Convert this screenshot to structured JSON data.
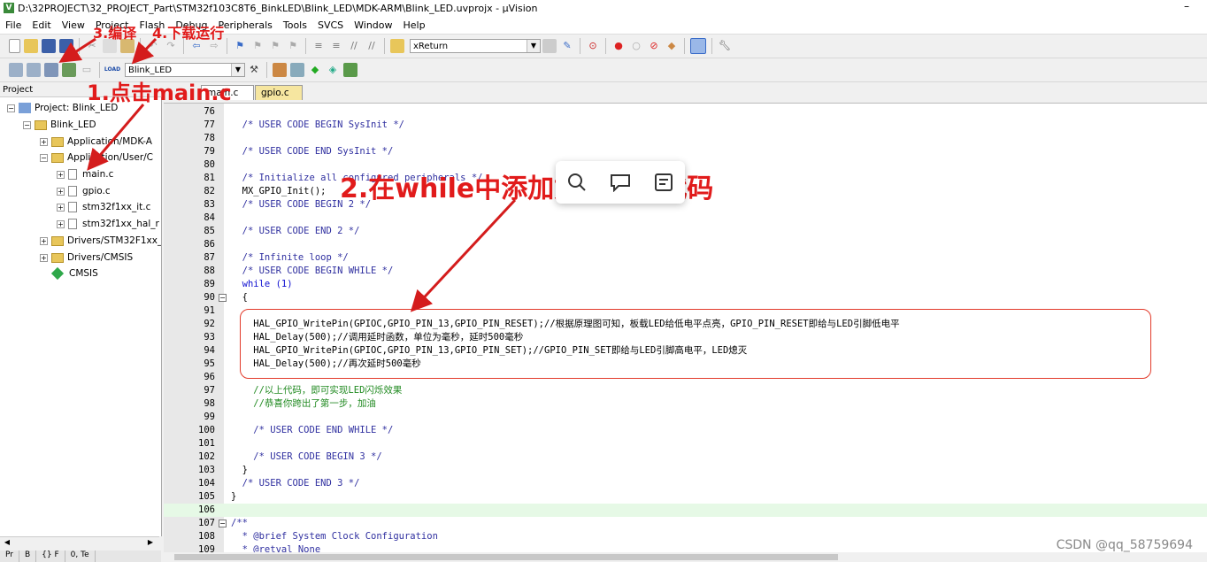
{
  "window": {
    "title": "D:\\32PROJECT\\32_PROJECT_Part\\STM32f103C8T6_BinkLED\\Blink_LED\\MDK-ARM\\Blink_LED.uvprojx - µVision",
    "app_icon_letter": "V",
    "minimize_glyph": "–"
  },
  "menu": [
    "File",
    "Edit",
    "View",
    "Project",
    "Flash",
    "Debug",
    "Peripherals",
    "Tools",
    "SVCS",
    "Window",
    "Help"
  ],
  "toolbar": {
    "find_combo_value": "xReturn",
    "target_combo_value": "Blink_LED",
    "load_label": "LOAD"
  },
  "project_panel": {
    "header": "Project",
    "tree": [
      {
        "label": "Project: Blink_LED",
        "indent": 0,
        "kind": "project",
        "expander": "−"
      },
      {
        "label": "Blink_LED",
        "indent": 1,
        "kind": "target",
        "expander": "−"
      },
      {
        "label": "Application/MDK-A",
        "indent": 2,
        "kind": "folder",
        "expander": "+"
      },
      {
        "label": "Application/User/C",
        "indent": 2,
        "kind": "folder",
        "expander": "−"
      },
      {
        "label": "main.c",
        "indent": 3,
        "kind": "file",
        "expander": "+"
      },
      {
        "label": "gpio.c",
        "indent": 3,
        "kind": "file",
        "expander": "+"
      },
      {
        "label": "stm32f1xx_it.c",
        "indent": 3,
        "kind": "file",
        "expander": "+"
      },
      {
        "label": "stm32f1xx_hal_r",
        "indent": 3,
        "kind": "file",
        "expander": "+"
      },
      {
        "label": "Drivers/STM32F1xx_",
        "indent": 2,
        "kind": "folder",
        "expander": "+"
      },
      {
        "label": "Drivers/CMSIS",
        "indent": 2,
        "kind": "folder",
        "expander": "+"
      },
      {
        "label": "CMSIS",
        "indent": 2,
        "kind": "diamond",
        "expander": ""
      }
    ],
    "bottom_tabs": [
      "Pr",
      "B",
      "{} F",
      "0, Te"
    ]
  },
  "editor": {
    "tabs": [
      "main.c",
      "gpio.c"
    ],
    "lines": [
      {
        "n": "76",
        "t": "",
        "c": "plain"
      },
      {
        "n": "77",
        "t": "  /* USER CODE BEGIN SysInit */",
        "c": "cm"
      },
      {
        "n": "78",
        "t": "",
        "c": "plain"
      },
      {
        "n": "79",
        "t": "  /* USER CODE END SysInit */",
        "c": "cm"
      },
      {
        "n": "80",
        "t": "",
        "c": "plain"
      },
      {
        "n": "81",
        "t": "  /* Initialize all configured peripherals */",
        "c": "cm"
      },
      {
        "n": "82",
        "t": "  MX_GPIO_Init();",
        "c": "plain"
      },
      {
        "n": "83",
        "t": "  /* USER CODE BEGIN 2 */",
        "c": "cm"
      },
      {
        "n": "84",
        "t": "",
        "c": "plain"
      },
      {
        "n": "85",
        "t": "  /* USER CODE END 2 */",
        "c": "cm"
      },
      {
        "n": "86",
        "t": "",
        "c": "plain"
      },
      {
        "n": "87",
        "t": "  /* Infinite loop */",
        "c": "cm"
      },
      {
        "n": "88",
        "t": "  /* USER CODE BEGIN WHILE */",
        "c": "cm"
      },
      {
        "n": "89",
        "t": "  while (1)",
        "c": "kw"
      },
      {
        "n": "90",
        "t": "  {",
        "c": "plain",
        "fold": "−"
      },
      {
        "n": "91",
        "t": "",
        "c": "plain"
      },
      {
        "n": "92",
        "t": "    HAL_GPIO_WritePin(GPIOC,GPIO_PIN_13,GPIO_PIN_RESET);//根据原理图可知，板载LED给低电平点亮，GPIO_PIN_RESET即给与LED引脚低电平",
        "c": "plain"
      },
      {
        "n": "93",
        "t": "    HAL_Delay(500);//调用延时函数，单位为毫秒，延时500毫秒",
        "c": "plain"
      },
      {
        "n": "94",
        "t": "    HAL_GPIO_WritePin(GPIOC,GPIO_PIN_13,GPIO_PIN_SET);//GPIO_PIN_SET即给与LED引脚高电平，LED熄灭",
        "c": "plain"
      },
      {
        "n": "95",
        "t": "    HAL_Delay(500);//再次延时500毫秒",
        "c": "plain"
      },
      {
        "n": "96",
        "t": "",
        "c": "plain"
      },
      {
        "n": "97",
        "t": "    //以上代码，即可实现LED闪烁效果",
        "c": "grn"
      },
      {
        "n": "98",
        "t": "    //恭喜你跨出了第一步，加油",
        "c": "grn"
      },
      {
        "n": "99",
        "t": "",
        "c": "plain"
      },
      {
        "n": "100",
        "t": "    /* USER CODE END WHILE */",
        "c": "cm"
      },
      {
        "n": "101",
        "t": "",
        "c": "plain"
      },
      {
        "n": "102",
        "t": "    /* USER CODE BEGIN 3 */",
        "c": "cm"
      },
      {
        "n": "103",
        "t": "  }",
        "c": "plain"
      },
      {
        "n": "104",
        "t": "  /* USER CODE END 3 */",
        "c": "cm"
      },
      {
        "n": "105",
        "t": "}",
        "c": "plain"
      },
      {
        "n": "106",
        "t": "",
        "c": "plain",
        "highlight": true
      },
      {
        "n": "107",
        "t": "/**",
        "c": "cm",
        "fold": "−"
      },
      {
        "n": "108",
        "t": "  * @brief System Clock Configuration",
        "c": "cm"
      },
      {
        "n": "109",
        "t": "  * @retval None",
        "c": "cm"
      }
    ]
  },
  "annotations": {
    "step1": "1.点击main.c",
    "step2": "2.在while中添加如下用户代码",
    "step3": "3.编译",
    "step4": "4.下载运行"
  },
  "popup_icons": [
    "search-icon",
    "comment-icon",
    "note-icon"
  ],
  "watermark": "CSDN @qq_58759694",
  "colors": {
    "annotation_red": "#e11b1b",
    "comment_blue": "#3030a0",
    "comment_green": "#218a21",
    "keyword_blue": "#1010d0"
  }
}
